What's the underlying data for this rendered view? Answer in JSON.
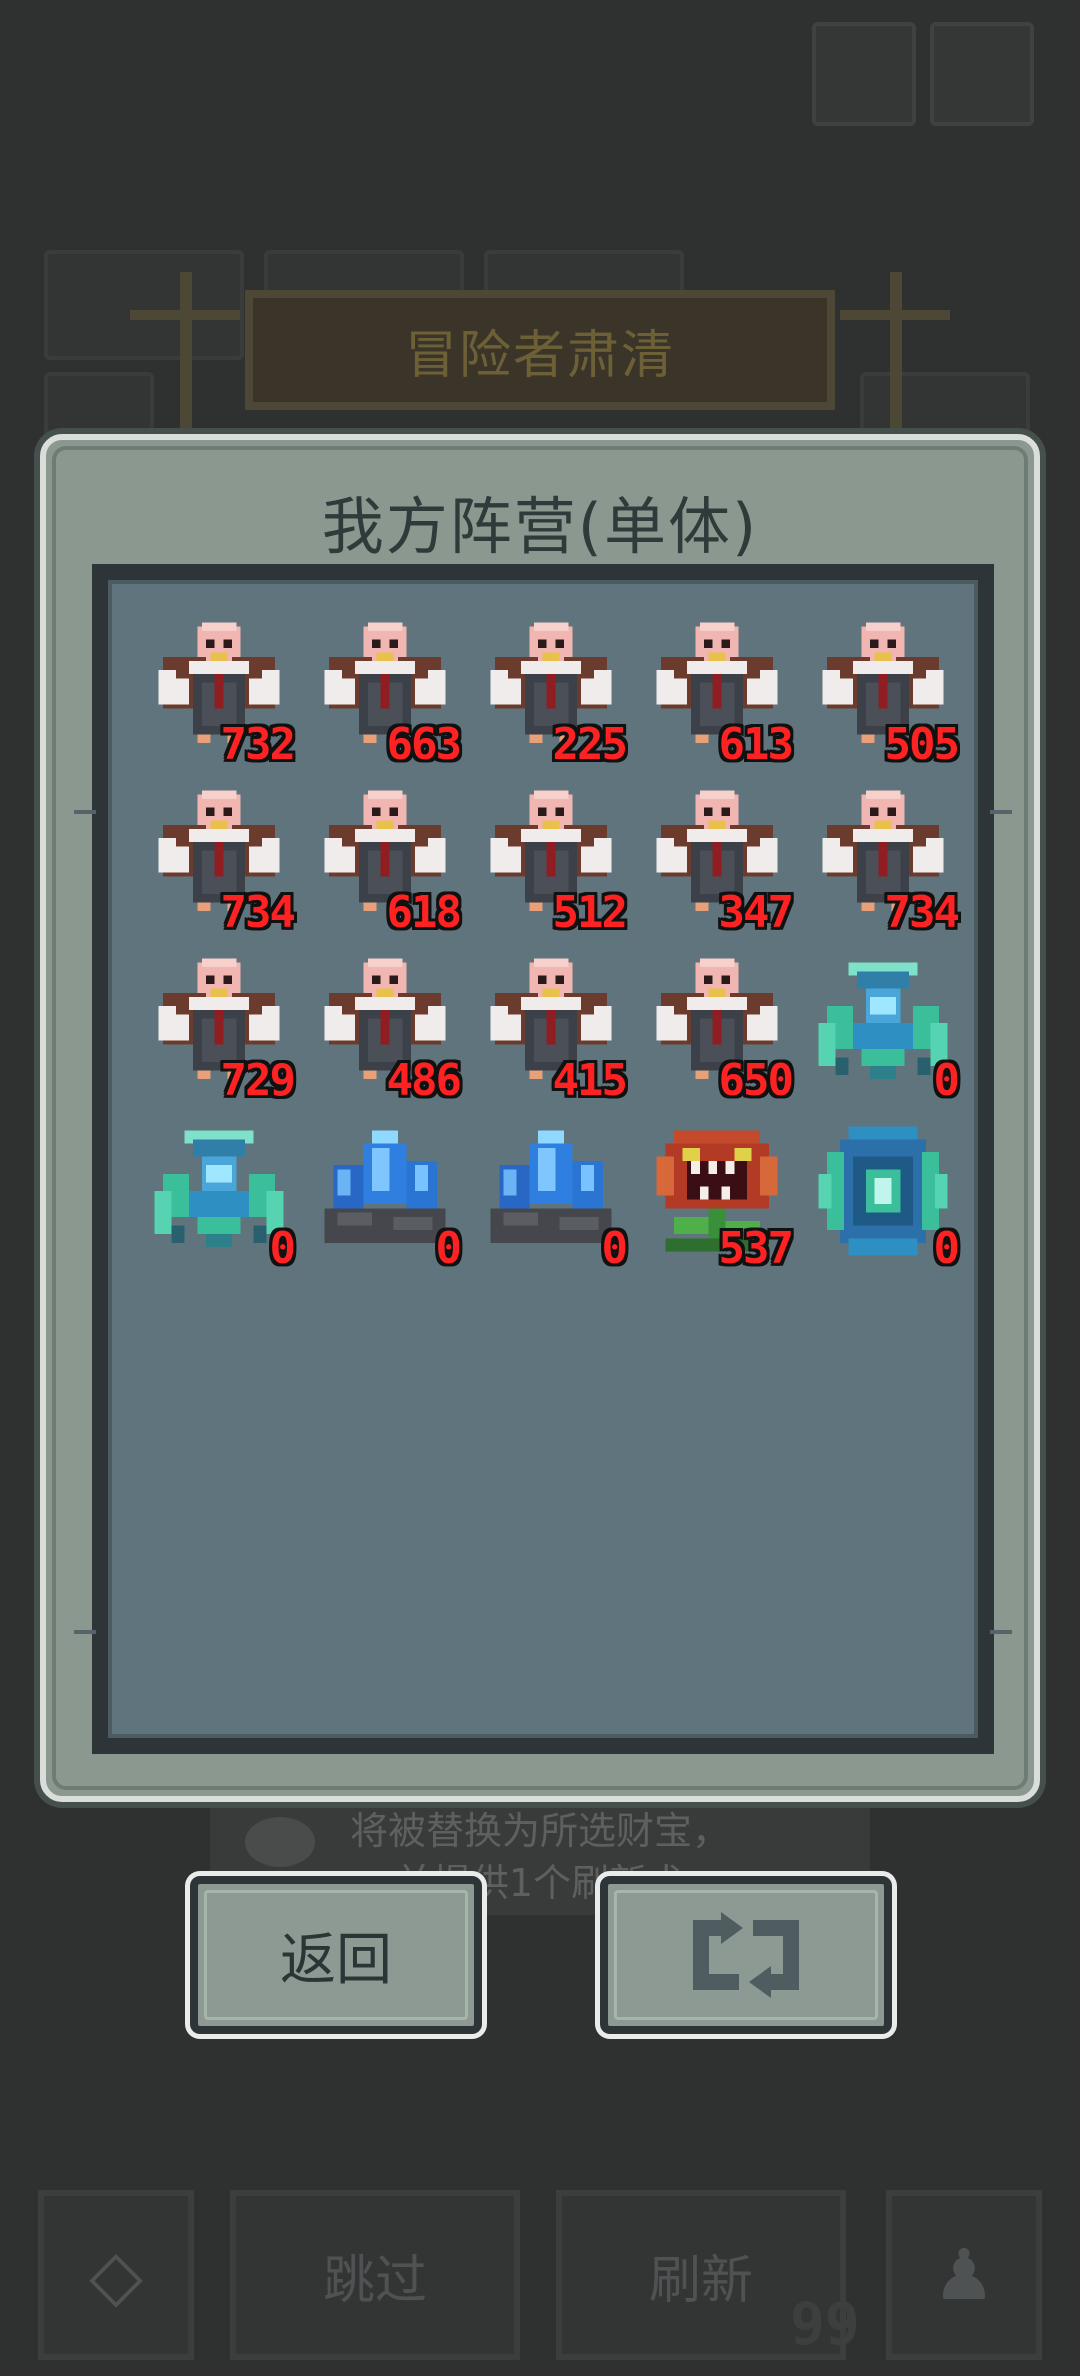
{
  "background": {
    "banner_title": "冒险者肃清",
    "hint_line1": "将被替换为所选财宝，",
    "hint_line2": "并提供1个刷新术",
    "skip_label": "跳过",
    "refresh_label": "刷新",
    "refresh_count": "99"
  },
  "dialog": {
    "title": "我方阵营(单体)",
    "back_label": "返回",
    "swap_icon": "refresh-arrows-icon"
  },
  "units": [
    {
      "kind": "vulture",
      "count": "732"
    },
    {
      "kind": "vulture",
      "count": "663"
    },
    {
      "kind": "vulture",
      "count": "225"
    },
    {
      "kind": "vulture",
      "count": "613"
    },
    {
      "kind": "vulture",
      "count": "505"
    },
    {
      "kind": "vulture",
      "count": "734"
    },
    {
      "kind": "vulture",
      "count": "618"
    },
    {
      "kind": "vulture",
      "count": "512"
    },
    {
      "kind": "vulture",
      "count": "347"
    },
    {
      "kind": "vulture",
      "count": "734"
    },
    {
      "kind": "vulture",
      "count": "729"
    },
    {
      "kind": "vulture",
      "count": "486"
    },
    {
      "kind": "vulture",
      "count": "415"
    },
    {
      "kind": "vulture",
      "count": "650"
    },
    {
      "kind": "crystal-turret",
      "count": "0"
    },
    {
      "kind": "crystal-turret",
      "count": "0"
    },
    {
      "kind": "crystal-rock",
      "count": "0"
    },
    {
      "kind": "crystal-rock",
      "count": "0"
    },
    {
      "kind": "man-eater-plant",
      "count": "537"
    },
    {
      "kind": "crystal-totem",
      "count": "0"
    }
  ]
}
